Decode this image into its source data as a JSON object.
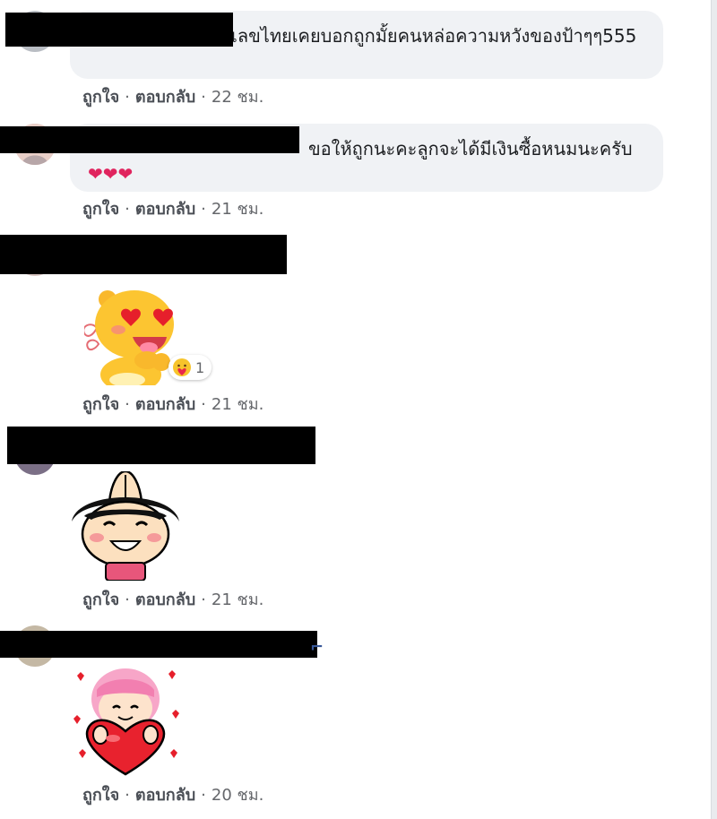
{
  "comments": [
    {
      "text": "เลขไทยเคยบอกถูกมั้ยคนหล่อความหวังของป้าๆๆ555",
      "like": "ถูกใจ",
      "reply": "ตอบกลับ",
      "time": "22 ชม."
    },
    {
      "text": "ขอให้ถูกนะคะลูกจะได้มีเงินซื้อหนมนะครับ",
      "like": "ถูกใจ",
      "reply": "ตอบกลับ",
      "time": "21 ชม."
    },
    {
      "sticker": "yellow-bear-heart-eyes-sticker",
      "reaction_count": "1",
      "like": "ถูกใจ",
      "reply": "ตอบกลับ",
      "time": "21 ชม."
    },
    {
      "sticker": "girl-praying-hands-sticker",
      "like": "ถูกใจ",
      "reply": "ตอบกลับ",
      "time": "21 ชม."
    },
    {
      "sticker": "pink-hair-girl-heart-sticker",
      "like": "ถูกใจ",
      "reply": "ตอบกลับ",
      "time": "20 ชม."
    }
  ],
  "colors": {
    "bubble": "#f0f2f5",
    "author": "#385898",
    "meta": "#65676b",
    "heart": "#e0245e"
  }
}
